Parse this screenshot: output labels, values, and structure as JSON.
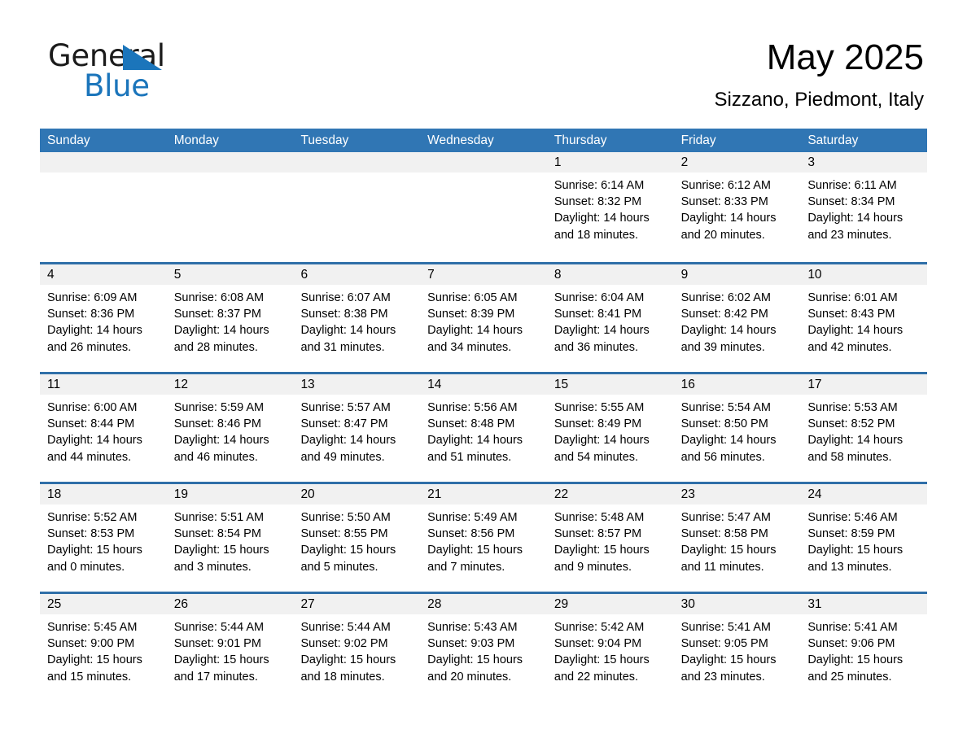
{
  "brand": {
    "name_part1": "General",
    "name_part2": "Blue",
    "triangle_color": "#1b75bb"
  },
  "header": {
    "title": "May 2025",
    "subtitle": "Sizzano, Piedmont, Italy"
  },
  "colors": {
    "header_bar": "#3076b4",
    "row_divider": "#2f6fa8",
    "day_band": "#f1f1f1",
    "brand_blue": "#1b75bb"
  },
  "weekdays": [
    "Sunday",
    "Monday",
    "Tuesday",
    "Wednesday",
    "Thursday",
    "Friday",
    "Saturday"
  ],
  "weeks": [
    [
      {
        "day": "",
        "lines": []
      },
      {
        "day": "",
        "lines": []
      },
      {
        "day": "",
        "lines": []
      },
      {
        "day": "",
        "lines": []
      },
      {
        "day": "1",
        "lines": [
          "Sunrise: 6:14 AM",
          "Sunset: 8:32 PM",
          "Daylight: 14 hours",
          "and 18 minutes."
        ]
      },
      {
        "day": "2",
        "lines": [
          "Sunrise: 6:12 AM",
          "Sunset: 8:33 PM",
          "Daylight: 14 hours",
          "and 20 minutes."
        ]
      },
      {
        "day": "3",
        "lines": [
          "Sunrise: 6:11 AM",
          "Sunset: 8:34 PM",
          "Daylight: 14 hours",
          "and 23 minutes."
        ]
      }
    ],
    [
      {
        "day": "4",
        "lines": [
          "Sunrise: 6:09 AM",
          "Sunset: 8:36 PM",
          "Daylight: 14 hours",
          "and 26 minutes."
        ]
      },
      {
        "day": "5",
        "lines": [
          "Sunrise: 6:08 AM",
          "Sunset: 8:37 PM",
          "Daylight: 14 hours",
          "and 28 minutes."
        ]
      },
      {
        "day": "6",
        "lines": [
          "Sunrise: 6:07 AM",
          "Sunset: 8:38 PM",
          "Daylight: 14 hours",
          "and 31 minutes."
        ]
      },
      {
        "day": "7",
        "lines": [
          "Sunrise: 6:05 AM",
          "Sunset: 8:39 PM",
          "Daylight: 14 hours",
          "and 34 minutes."
        ]
      },
      {
        "day": "8",
        "lines": [
          "Sunrise: 6:04 AM",
          "Sunset: 8:41 PM",
          "Daylight: 14 hours",
          "and 36 minutes."
        ]
      },
      {
        "day": "9",
        "lines": [
          "Sunrise: 6:02 AM",
          "Sunset: 8:42 PM",
          "Daylight: 14 hours",
          "and 39 minutes."
        ]
      },
      {
        "day": "10",
        "lines": [
          "Sunrise: 6:01 AM",
          "Sunset: 8:43 PM",
          "Daylight: 14 hours",
          "and 42 minutes."
        ]
      }
    ],
    [
      {
        "day": "11",
        "lines": [
          "Sunrise: 6:00 AM",
          "Sunset: 8:44 PM",
          "Daylight: 14 hours",
          "and 44 minutes."
        ]
      },
      {
        "day": "12",
        "lines": [
          "Sunrise: 5:59 AM",
          "Sunset: 8:46 PM",
          "Daylight: 14 hours",
          "and 46 minutes."
        ]
      },
      {
        "day": "13",
        "lines": [
          "Sunrise: 5:57 AM",
          "Sunset: 8:47 PM",
          "Daylight: 14 hours",
          "and 49 minutes."
        ]
      },
      {
        "day": "14",
        "lines": [
          "Sunrise: 5:56 AM",
          "Sunset: 8:48 PM",
          "Daylight: 14 hours",
          "and 51 minutes."
        ]
      },
      {
        "day": "15",
        "lines": [
          "Sunrise: 5:55 AM",
          "Sunset: 8:49 PM",
          "Daylight: 14 hours",
          "and 54 minutes."
        ]
      },
      {
        "day": "16",
        "lines": [
          "Sunrise: 5:54 AM",
          "Sunset: 8:50 PM",
          "Daylight: 14 hours",
          "and 56 minutes."
        ]
      },
      {
        "day": "17",
        "lines": [
          "Sunrise: 5:53 AM",
          "Sunset: 8:52 PM",
          "Daylight: 14 hours",
          "and 58 minutes."
        ]
      }
    ],
    [
      {
        "day": "18",
        "lines": [
          "Sunrise: 5:52 AM",
          "Sunset: 8:53 PM",
          "Daylight: 15 hours",
          "and 0 minutes."
        ]
      },
      {
        "day": "19",
        "lines": [
          "Sunrise: 5:51 AM",
          "Sunset: 8:54 PM",
          "Daylight: 15 hours",
          "and 3 minutes."
        ]
      },
      {
        "day": "20",
        "lines": [
          "Sunrise: 5:50 AM",
          "Sunset: 8:55 PM",
          "Daylight: 15 hours",
          "and 5 minutes."
        ]
      },
      {
        "day": "21",
        "lines": [
          "Sunrise: 5:49 AM",
          "Sunset: 8:56 PM",
          "Daylight: 15 hours",
          "and 7 minutes."
        ]
      },
      {
        "day": "22",
        "lines": [
          "Sunrise: 5:48 AM",
          "Sunset: 8:57 PM",
          "Daylight: 15 hours",
          "and 9 minutes."
        ]
      },
      {
        "day": "23",
        "lines": [
          "Sunrise: 5:47 AM",
          "Sunset: 8:58 PM",
          "Daylight: 15 hours",
          "and 11 minutes."
        ]
      },
      {
        "day": "24",
        "lines": [
          "Sunrise: 5:46 AM",
          "Sunset: 8:59 PM",
          "Daylight: 15 hours",
          "and 13 minutes."
        ]
      }
    ],
    [
      {
        "day": "25",
        "lines": [
          "Sunrise: 5:45 AM",
          "Sunset: 9:00 PM",
          "Daylight: 15 hours",
          "and 15 minutes."
        ]
      },
      {
        "day": "26",
        "lines": [
          "Sunrise: 5:44 AM",
          "Sunset: 9:01 PM",
          "Daylight: 15 hours",
          "and 17 minutes."
        ]
      },
      {
        "day": "27",
        "lines": [
          "Sunrise: 5:44 AM",
          "Sunset: 9:02 PM",
          "Daylight: 15 hours",
          "and 18 minutes."
        ]
      },
      {
        "day": "28",
        "lines": [
          "Sunrise: 5:43 AM",
          "Sunset: 9:03 PM",
          "Daylight: 15 hours",
          "and 20 minutes."
        ]
      },
      {
        "day": "29",
        "lines": [
          "Sunrise: 5:42 AM",
          "Sunset: 9:04 PM",
          "Daylight: 15 hours",
          "and 22 minutes."
        ]
      },
      {
        "day": "30",
        "lines": [
          "Sunrise: 5:41 AM",
          "Sunset: 9:05 PM",
          "Daylight: 15 hours",
          "and 23 minutes."
        ]
      },
      {
        "day": "31",
        "lines": [
          "Sunrise: 5:41 AM",
          "Sunset: 9:06 PM",
          "Daylight: 15 hours",
          "and 25 minutes."
        ]
      }
    ]
  ]
}
